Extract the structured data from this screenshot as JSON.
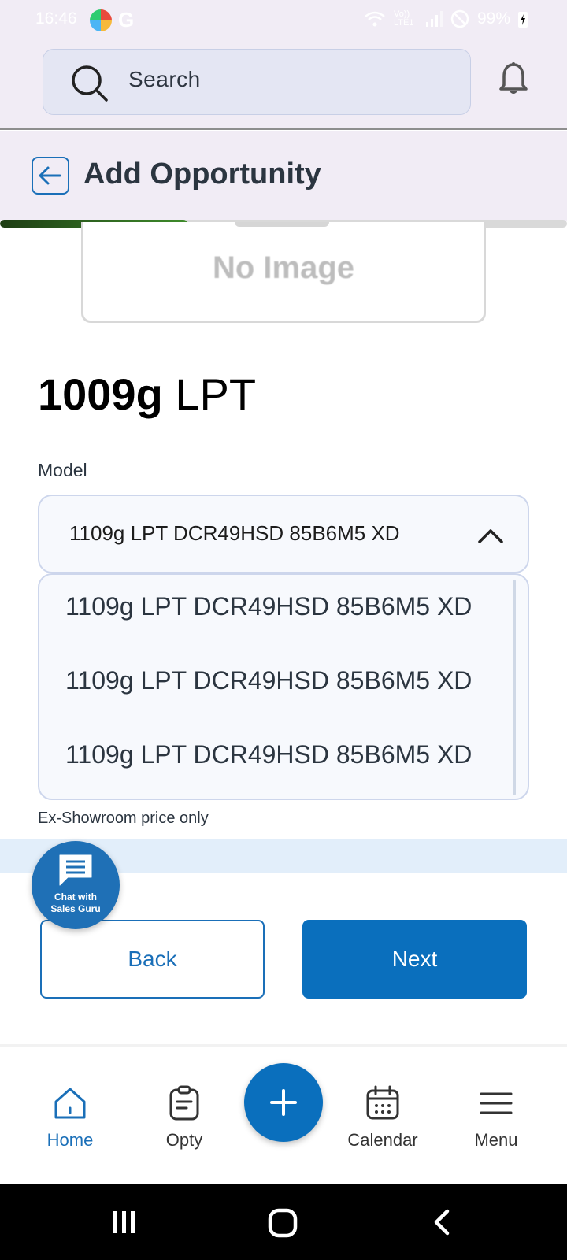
{
  "status_bar": {
    "time": "16:46",
    "battery": "99%",
    "network": "Vo)) LTE1"
  },
  "header": {
    "search_placeholder": "Search"
  },
  "page": {
    "title": "Add Opportunity",
    "progress_fraction": 0.33
  },
  "image_placeholder": {
    "label": "No Image"
  },
  "product": {
    "name_bold": "1009g",
    "name_rest": "LPT"
  },
  "model_field": {
    "label": "Model",
    "selected": "1109g LPT DCR49HSD 85B6M5 XD",
    "options": [
      "1109g LPT DCR49HSD 85B6M5 XD",
      "1109g LPT DCR49HSD 85B6M5 XD",
      "1109g LPT DCR49HSD 85B6M5 XD"
    ],
    "hint": "Ex-Showroom price only"
  },
  "chat": {
    "line1": "Chat with",
    "line2": "Sales Guru"
  },
  "actions": {
    "back_label": "Back",
    "next_label": "Next"
  },
  "bottom_nav": {
    "home": "Home",
    "opty": "Opty",
    "calendar": "Calendar",
    "menu": "Menu"
  },
  "colors": {
    "primary": "#0a6fbd",
    "progress": "#3e8b2b",
    "header_bg": "#f1ecf5"
  }
}
